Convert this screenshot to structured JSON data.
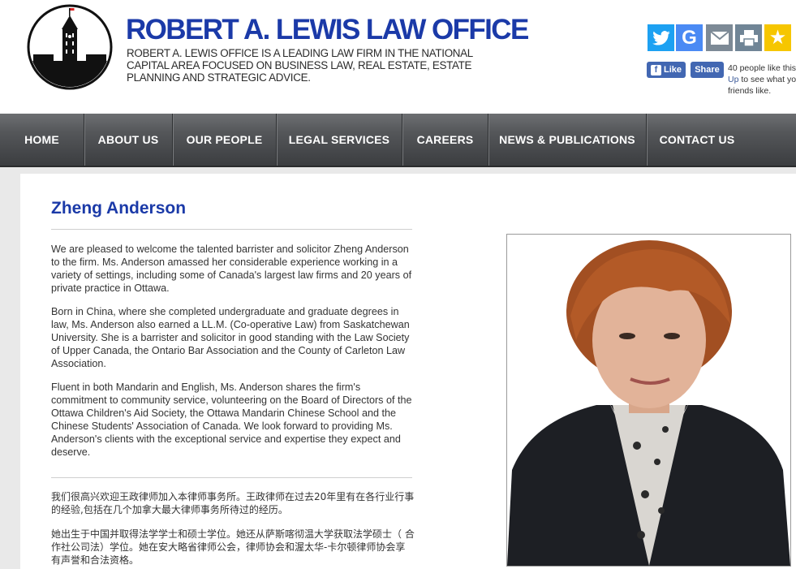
{
  "header": {
    "title": "ROBERT A. LEWIS LAW OFFICE",
    "tagline": "ROBERT A. LEWIS OFFICE IS A LEADING LAW FIRM IN THE NATIONAL CAPITAL AREA FOCUSED ON BUSINESS LAW, REAL ESTATE, ESTATE PLANNING AND STRATEGIC ADVICE.",
    "logo_icon": "parliament-peace-tower-icon"
  },
  "share": {
    "icons": [
      "twitter-icon",
      "google-icon",
      "email-icon",
      "print-icon",
      "favorite-icon"
    ],
    "colors": {
      "twitter": "#1da1f2",
      "google": "#4a8af4",
      "email": "#7d8a96",
      "print": "#708596",
      "favorite": "#f6c600"
    },
    "facebook": {
      "like_label": "Like",
      "share_label": "Share",
      "note_line1": "40 people like this",
      "note_link": "Up",
      "note_line2_rest": " to see what yo",
      "note_line3": "friends like."
    }
  },
  "nav": {
    "items": [
      {
        "label": "HOME"
      },
      {
        "label": "ABOUT US"
      },
      {
        "label": "OUR PEOPLE"
      },
      {
        "label": "LEGAL SERVICES"
      },
      {
        "label": "CAREERS"
      },
      {
        "label": "NEWS & PUBLICATIONS"
      },
      {
        "label": "CONTACT US"
      }
    ]
  },
  "profile": {
    "name": "Zheng Anderson",
    "paragraphs": [
      "We are pleased to welcome the talented barrister and solicitor Zheng Anderson to the firm. Ms. Anderson amassed her considerable experience working in a variety of settings, including some of Canada's largest law firms and 20 years of private practice in Ottawa.",
      "Born in China, where she completed undergraduate and graduate degrees in law, Ms. Anderson also earned a LL.M. (Co-operative Law) from Saskatchewan University. She is a barrister and solicitor in good standing with the Law Society of Upper Canada, the Ontario Bar Association and the County of Carleton Law Association.",
      "Fluent in both Mandarin and English, Ms. Anderson shares the firm's commitment to community service, volunteering on the Board of Directors of the Ottawa Children's Aid Society, the Ottawa Mandarin Chinese School and the Chinese Students' Association of Canada. We look forward to providing Ms. Anderson's clients with the exceptional service and expertise they expect and deserve."
    ],
    "paragraphs_zh": [
      "我们很高兴欢迎王政律师加入本律师事务所。王政律师在过去20年里有在各行业行事 的经验,包括在几个加拿大最大律师事务所待过的经历。",
      "她出生于中国并取得法学学士和硕士学位。她还从萨斯喀彻温大学获取法学硕士（ 合作社公司法）学位。她在安大略省律师公会，律师协会和渥太华-卡尔顿律师协会享 有声誉和合法资格。"
    ],
    "photo_icon": "portrait-photo"
  }
}
